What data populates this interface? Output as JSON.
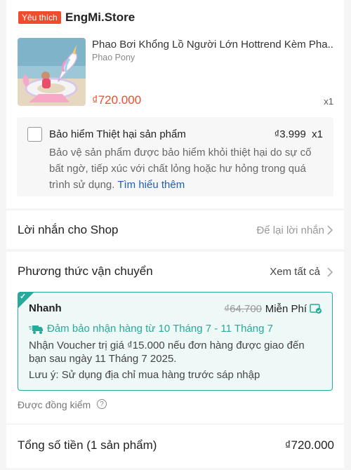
{
  "shop": {
    "badge": "Yêu thích",
    "name": "EngMi.Store"
  },
  "product": {
    "title": "Phao Bơi Khổng Lồ Người Lớn Hottrend Kèm Pha...",
    "variant": "Phao Pony",
    "price": "₫720.000",
    "qty": "x1",
    "image_icon": "unicorn-float-photo"
  },
  "insurance": {
    "title": "Bảo hiểm Thiệt hại sản phẩm",
    "price": "₫3.999",
    "qty": "x1",
    "description": "Bảo vệ sản phẩm được bảo hiểm khỏi thiệt hại do sự cố bất ngờ, tiếp xúc với chất lỏng hoặc hư hỏng trong quá trình sử dụng.",
    "link": "Tìm hiểu thêm",
    "checked": false
  },
  "message": {
    "label": "Lời nhắn cho Shop",
    "placeholder": "Để lại lời nhắn"
  },
  "shipping": {
    "title": "Phương thức vận chuyển",
    "see_all": "Xem tất cả",
    "option": {
      "name": "Nhanh",
      "old_fee": "₫64.700",
      "fee": "Miễn Phí",
      "guarantee": "Đảm bảo nhận hàng từ 10 Tháng 7 - 11 Tháng 7",
      "voucher": "Nhận Voucher trị giá ₫15.000 nếu đơn hàng được giao đến bạn sau ngày 11 Tháng 7 2025.",
      "note": "Lưu ý: Sử dụng địa chỉ mua hàng trước sáp nhập"
    },
    "checked_label": "Được đồng kiểm"
  },
  "total": {
    "label": "Tổng số tiền (1 sản phẩm)",
    "value": "₫720.000"
  },
  "colors": {
    "accent": "#ee4d2d",
    "teal": "#26aa99",
    "link": "#1e5fb4"
  }
}
